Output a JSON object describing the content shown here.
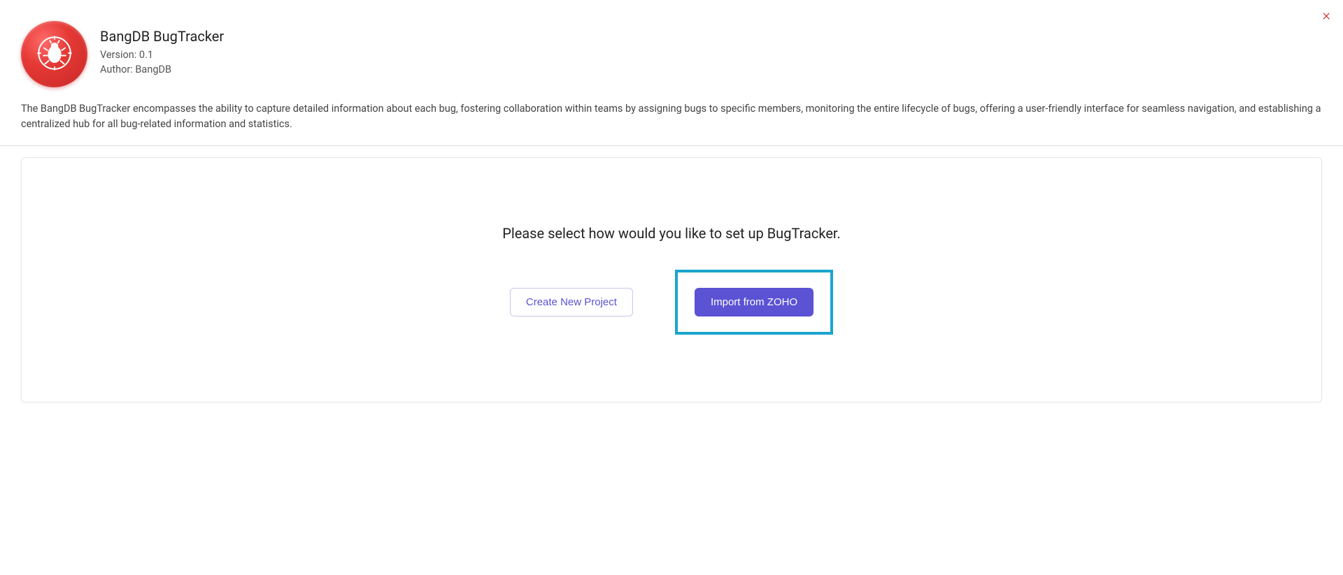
{
  "close": {
    "label": "×"
  },
  "app": {
    "title": "BangDB BugTracker",
    "version_line": "Version: 0.1",
    "author_line": "Author: BangDB",
    "description": "The BangDB BugTracker encompasses the ability to capture detailed information about each bug, fostering collaboration within teams by assigning bugs to specific members, monitoring the entire lifecycle of bugs, offering a user-friendly interface for seamless navigation, and establishing a centralized hub for all bug-related information and statistics."
  },
  "setup": {
    "prompt": "Please select how would you like to set up BugTracker.",
    "create_label": "Create New Project",
    "import_label": "Import from ZOHO"
  }
}
